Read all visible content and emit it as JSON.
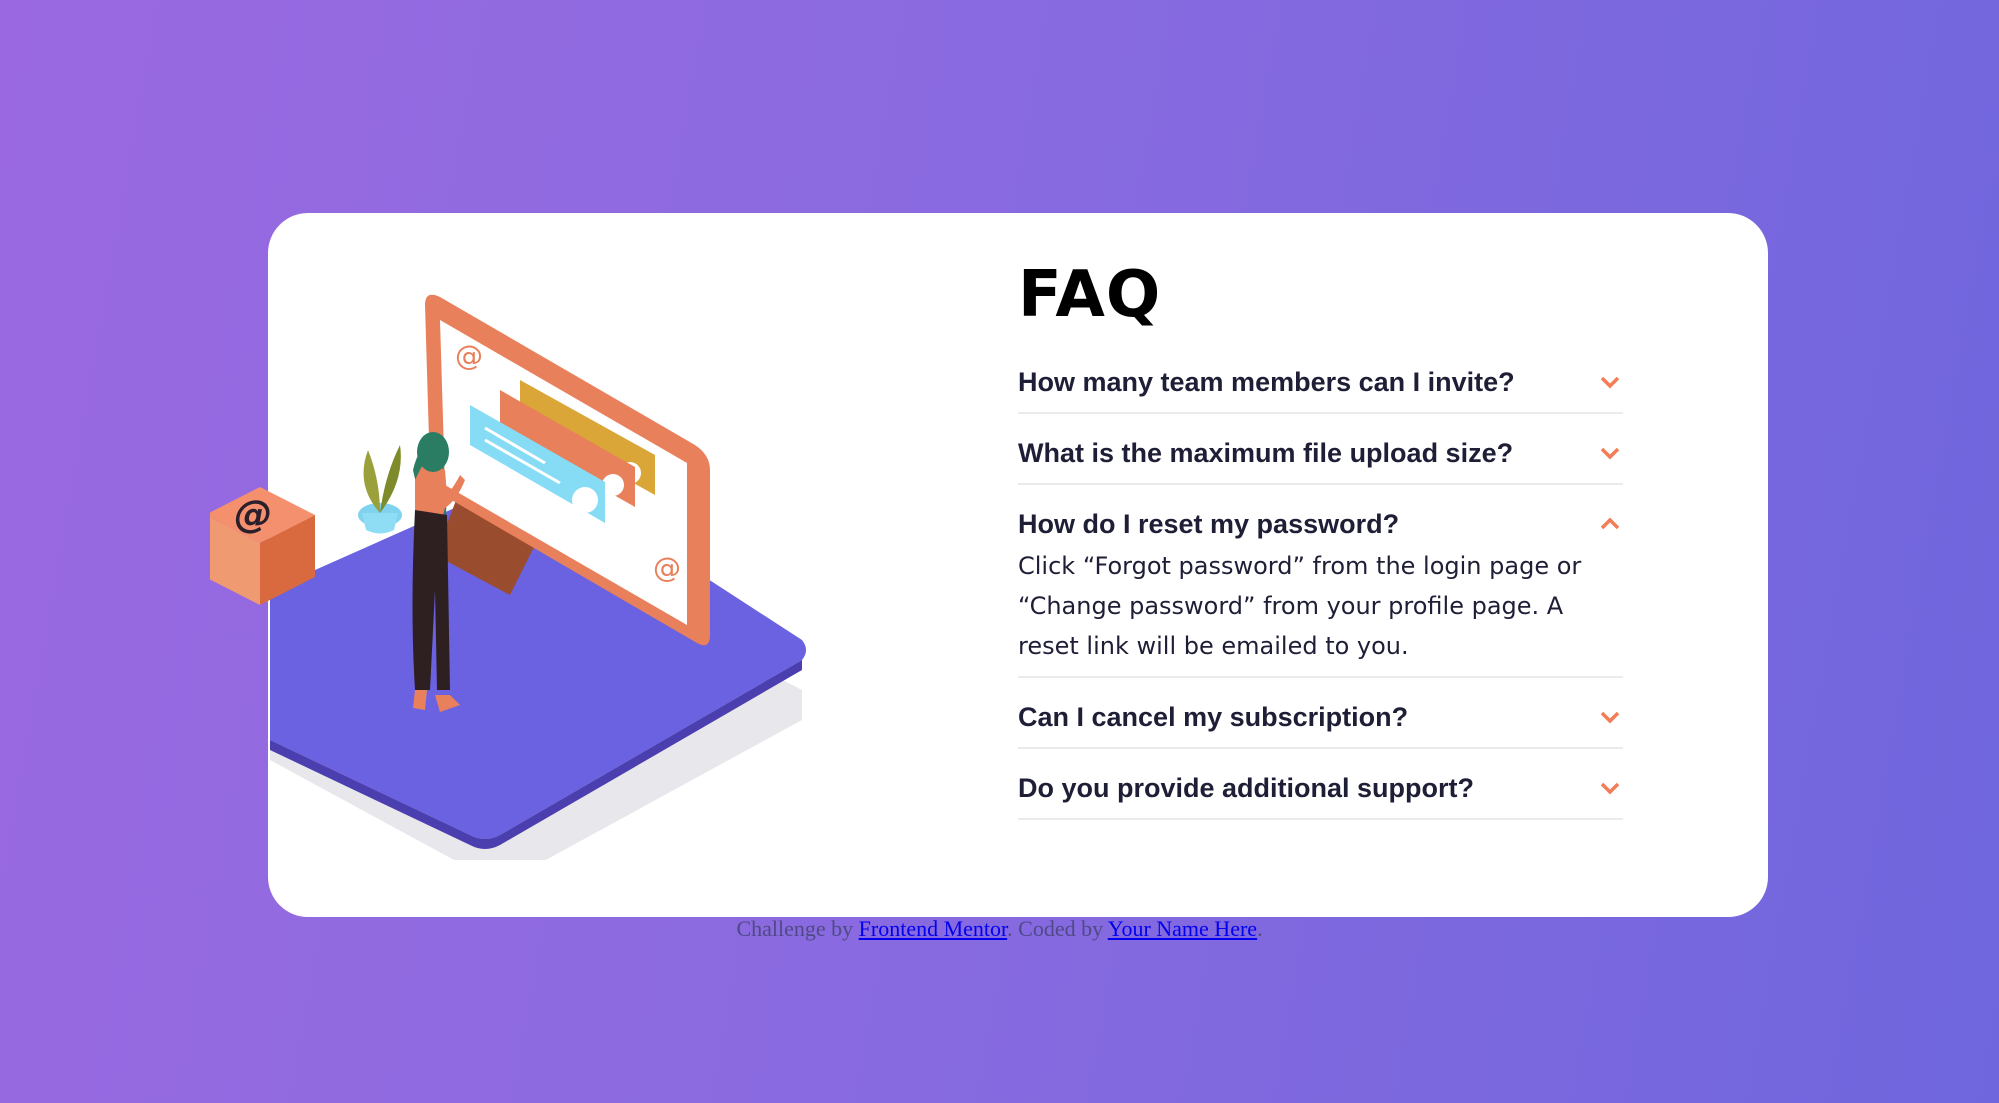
{
  "faq": {
    "title": "FAQ",
    "items": [
      {
        "question": "How many team members can I invite?",
        "expanded": false,
        "chevron": "chevron-down-icon"
      },
      {
        "question": "What is the maximum file upload size?",
        "expanded": false,
        "chevron": "chevron-down-icon"
      },
      {
        "question": "How do I reset my password?",
        "expanded": true,
        "chevron": "chevron-up-icon",
        "answer": "Click “Forgot password” from the login page or “Change password” from your profile page. A reset link will be emailed to you."
      },
      {
        "question": "Can I cancel my subscription?",
        "expanded": false,
        "chevron": "chevron-down-icon"
      },
      {
        "question": "Do you provide additional support?",
        "expanded": false,
        "chevron": "chevron-down-icon"
      }
    ]
  },
  "attribution": {
    "prefix": "Challenge by ",
    "link1": "Frontend Mentor",
    "middle": ". Coded by ",
    "link2": "Your Name Here",
    "suffix": "."
  },
  "colors": {
    "background_start": "#9a69e1",
    "background_end": "#6f66dd",
    "accent_chevron": "#f47c57",
    "text_dark": "#1e1f36",
    "divider": "#ebebee"
  }
}
